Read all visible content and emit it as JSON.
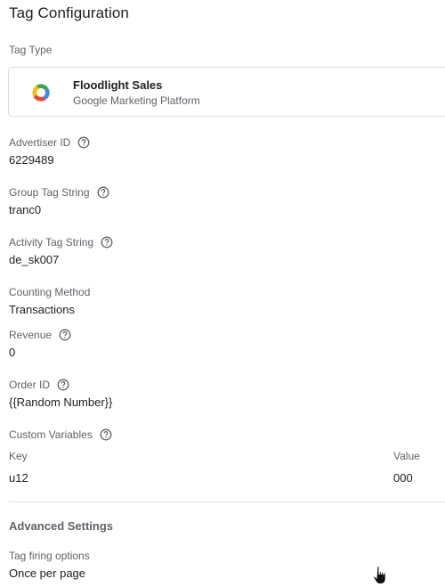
{
  "title": "Tag Configuration",
  "tag_type": {
    "label": "Tag Type",
    "name": "Floodlight Sales",
    "vendor": "Google Marketing Platform",
    "icon": "google-marketing-platform-icon"
  },
  "fields": {
    "advertiser_id": {
      "label": "Advertiser ID",
      "value": "6229489"
    },
    "group_tag_string": {
      "label": "Group Tag String",
      "value": "tranc0"
    },
    "activity_tag_string": {
      "label": "Activity Tag String",
      "value": "de_sk007"
    },
    "counting_method": {
      "label": "Counting Method",
      "value": "Transactions"
    },
    "revenue": {
      "label": "Revenue",
      "value": "0"
    },
    "order_id": {
      "label": "Order ID",
      "value": "{{Random Number}}"
    },
    "custom_variables": {
      "label": "Custom Variables"
    }
  },
  "custom_variables_table": {
    "key_header": "Key",
    "value_header": "Value",
    "rows": [
      {
        "key": "u12",
        "value": "000"
      }
    ]
  },
  "advanced": {
    "title": "Advanced Settings",
    "tag_firing_options": {
      "label": "Tag firing options",
      "value": "Once per page"
    }
  },
  "colors": {
    "label_gray": "#5f6368",
    "text": "#202124",
    "border": "#dadce0"
  }
}
